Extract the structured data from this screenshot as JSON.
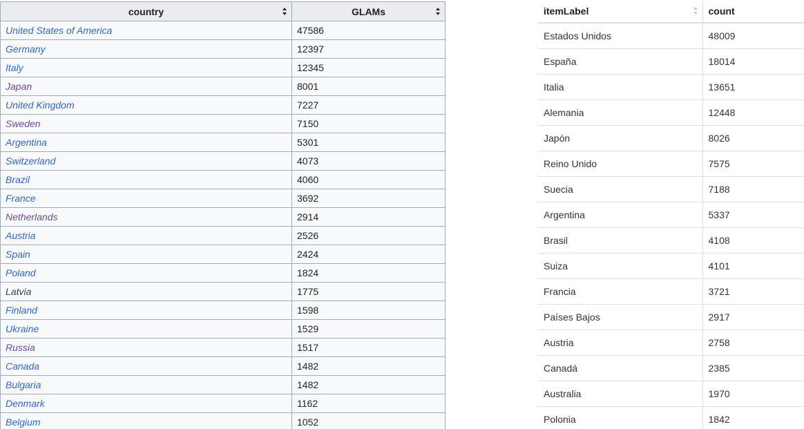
{
  "left_table": {
    "headers": {
      "country": "country",
      "glams": "GLAMs"
    },
    "rows": [
      {
        "country": "United States of America",
        "glams": "47586",
        "link": "link"
      },
      {
        "country": "Germany",
        "glams": "12397",
        "link": "link"
      },
      {
        "country": "Italy",
        "glams": "12345",
        "link": "link"
      },
      {
        "country": "Japan",
        "glams": "8001",
        "link": "visited"
      },
      {
        "country": "United Kingdom",
        "glams": "7227",
        "link": "link"
      },
      {
        "country": "Sweden",
        "glams": "7150",
        "link": "visited"
      },
      {
        "country": "Argentina",
        "glams": "5301",
        "link": "link"
      },
      {
        "country": "Switzerland",
        "glams": "4073",
        "link": "link"
      },
      {
        "country": "Brazil",
        "glams": "4060",
        "link": "link"
      },
      {
        "country": "France",
        "glams": "3692",
        "link": "link"
      },
      {
        "country": "Netherlands",
        "glams": "2914",
        "link": "visited"
      },
      {
        "country": "Austria",
        "glams": "2526",
        "link": "link"
      },
      {
        "country": "Spain",
        "glams": "2424",
        "link": "link"
      },
      {
        "country": "Poland",
        "glams": "1824",
        "link": "link"
      },
      {
        "country": "Latvia",
        "glams": "1775",
        "link": "plain"
      },
      {
        "country": "Finland",
        "glams": "1598",
        "link": "link"
      },
      {
        "country": "Ukraine",
        "glams": "1529",
        "link": "link"
      },
      {
        "country": "Russia",
        "glams": "1517",
        "link": "visited"
      },
      {
        "country": "Canada",
        "glams": "1482",
        "link": "link"
      },
      {
        "country": "Bulgaria",
        "glams": "1482",
        "link": "link"
      },
      {
        "country": "Denmark",
        "glams": "1162",
        "link": "link"
      },
      {
        "country": "Belgium",
        "glams": "1052",
        "link": "link"
      }
    ]
  },
  "right_table": {
    "headers": {
      "label": "itemLabel",
      "count": "count"
    },
    "rows": [
      {
        "label": "Estados Unidos",
        "count": "48009"
      },
      {
        "label": "España",
        "count": "18014"
      },
      {
        "label": "Italia",
        "count": "13651"
      },
      {
        "label": "Alemania",
        "count": "12448"
      },
      {
        "label": "Japón",
        "count": "8026"
      },
      {
        "label": "Reino Unido",
        "count": "7575"
      },
      {
        "label": "Suecia",
        "count": "7188"
      },
      {
        "label": "Argentina",
        "count": "5337"
      },
      {
        "label": "Brasil",
        "count": "4108"
      },
      {
        "label": "Suiza",
        "count": "4101"
      },
      {
        "label": "Francia",
        "count": "3721"
      },
      {
        "label": "Países Bajos",
        "count": "2917"
      },
      {
        "label": "Austria",
        "count": "2758"
      },
      {
        "label": "Canadá",
        "count": "2385"
      },
      {
        "label": "Australia",
        "count": "1970"
      },
      {
        "label": "Polonia",
        "count": "1842"
      }
    ]
  },
  "colors": {
    "link": "#3366cc",
    "visited_link": "#6b4ba1",
    "header_bg": "#eaecf0",
    "cell_bg": "#f8f9fa",
    "border": "#a2a9b1"
  },
  "icons": {
    "sort_active": "sort-arrows-icon",
    "sort_inactive": "sort-arrows-inactive-icon"
  }
}
